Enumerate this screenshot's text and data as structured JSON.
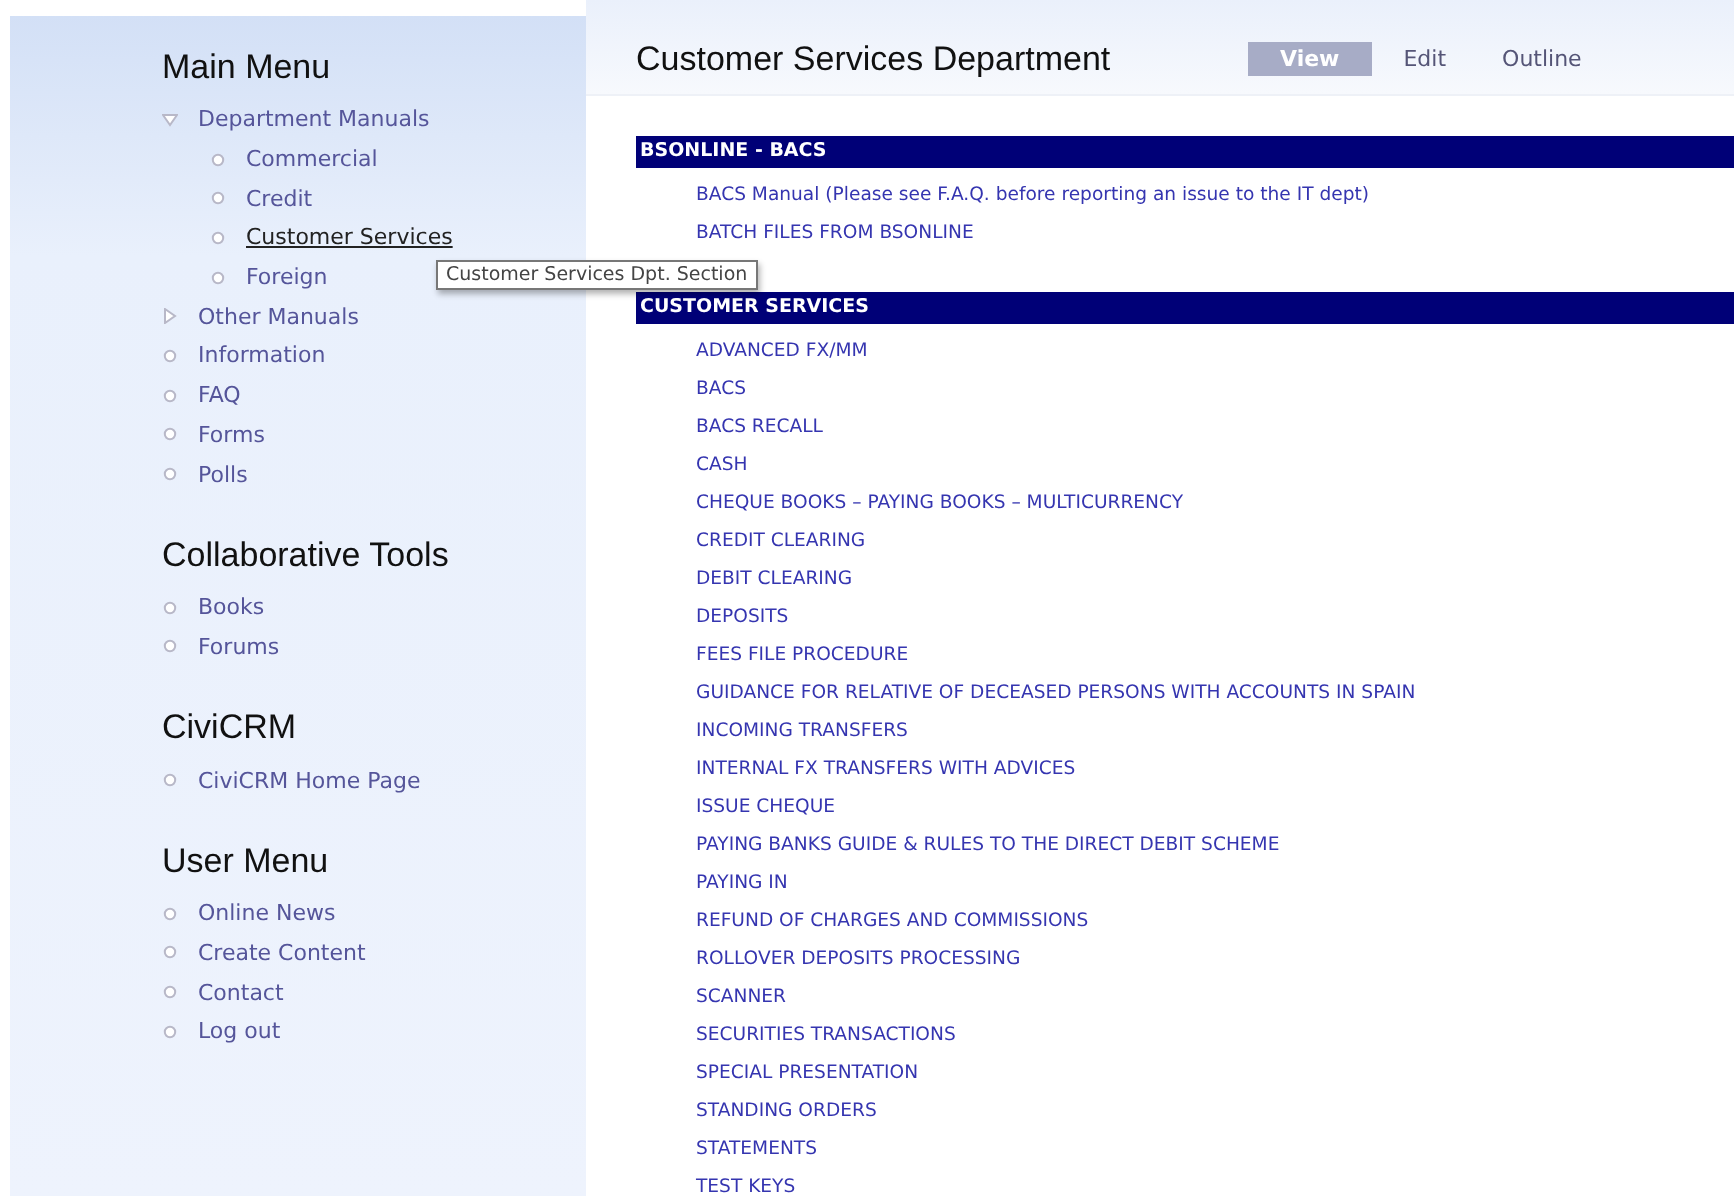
{
  "sidebar": {
    "blocks": [
      {
        "title": "Main Menu",
        "items": [
          {
            "label": "Department Manuals",
            "kind": "folder",
            "expanded": true,
            "selected": false,
            "children": [
              {
                "label": "Commercial",
                "kind": "leaf",
                "selected": false
              },
              {
                "label": "Credit",
                "kind": "leaf",
                "selected": false
              },
              {
                "label": "Customer Services",
                "kind": "leaf",
                "selected": true
              },
              {
                "label": "Foreign",
                "kind": "leaf",
                "selected": false
              }
            ]
          },
          {
            "label": "Other Manuals",
            "kind": "folder",
            "expanded": false,
            "selected": false
          },
          {
            "label": "Information",
            "kind": "leaf",
            "selected": false
          },
          {
            "label": "FAQ",
            "kind": "leaf",
            "selected": false
          },
          {
            "label": "Forms",
            "kind": "leaf",
            "selected": false
          },
          {
            "label": "Polls",
            "kind": "leaf",
            "selected": false
          }
        ]
      },
      {
        "title": "Collaborative Tools",
        "items": [
          {
            "label": "Books",
            "kind": "leaf",
            "selected": false
          },
          {
            "label": "Forums",
            "kind": "leaf",
            "selected": false
          }
        ]
      },
      {
        "title": "CiviCRM",
        "items": [
          {
            "label": "CiviCRM Home Page",
            "kind": "leaf",
            "selected": false
          }
        ]
      },
      {
        "title": "User Menu",
        "items": [
          {
            "label": "Online News",
            "kind": "leaf",
            "selected": false
          },
          {
            "label": "Create Content",
            "kind": "leaf",
            "selected": false
          },
          {
            "label": "Contact",
            "kind": "leaf",
            "selected": false
          },
          {
            "label": "Log out",
            "kind": "leaf",
            "selected": false
          }
        ]
      }
    ]
  },
  "tooltip": "Customer Services Dpt. Section",
  "page": {
    "title": "Customer Services Department",
    "tabs": [
      {
        "label": "View",
        "selected": true
      },
      {
        "label": "Edit",
        "selected": false
      },
      {
        "label": "Outline",
        "selected": false
      }
    ],
    "sections": [
      {
        "heading": "BSONLINE - BACS",
        "links": [
          "BACS Manual (Please see F.A.Q. before reporting an issue to the IT dept)",
          "BATCH FILES FROM BSONLINE"
        ]
      },
      {
        "heading": "CUSTOMER SERVICES",
        "links": [
          "ADVANCED FX/MM",
          "BACS",
          "BACS RECALL",
          "CASH",
          "CHEQUE BOOKS – PAYING BOOKS – MULTICURRENCY",
          "CREDIT CLEARING",
          "DEBIT CLEARING",
          "DEPOSITS",
          "FEES FILE PROCEDURE",
          "GUIDANCE FOR RELATIVE OF DECEASED PERSONS WITH ACCOUNTS IN SPAIN",
          "INCOMING TRANSFERS",
          "INTERNAL FX TRANSFERS WITH ADVICES",
          "ISSUE CHEQUE",
          "PAYING BANKS GUIDE & RULES TO THE DIRECT DEBIT SCHEME",
          "PAYING IN",
          "REFUND OF CHARGES AND COMMISSIONS",
          "ROLLOVER DEPOSITS PROCESSING",
          "SCANNER",
          "SECURITIES TRANSACTIONS",
          "SPECIAL PRESENTATION",
          "STANDING ORDERS",
          "STATEMENTS",
          "TEST KEYS"
        ]
      }
    ]
  }
}
